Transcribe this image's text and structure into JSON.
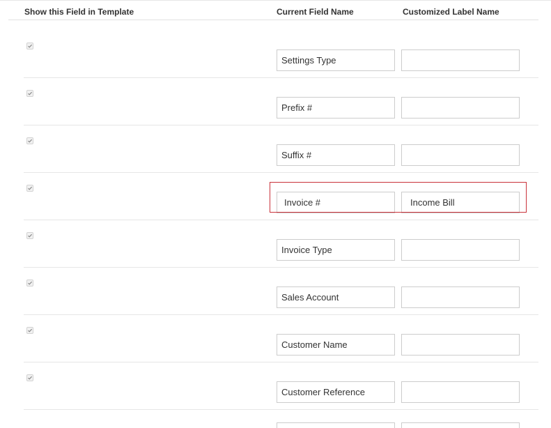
{
  "table": {
    "headers": {
      "show": "Show this Field in Template",
      "current": "Current Field Name",
      "custom": "Customized Label Name"
    },
    "rows": [
      {
        "current_name": "Settings Type",
        "custom_label": "",
        "checked": true
      },
      {
        "current_name": "Prefix #",
        "custom_label": "",
        "checked": true
      },
      {
        "current_name": "Suffix #",
        "custom_label": "",
        "checked": true
      },
      {
        "current_name": "Invoice #",
        "custom_label": "Income Bill",
        "checked": true,
        "highlighted": true
      },
      {
        "current_name": "Invoice Type",
        "custom_label": "",
        "checked": true
      },
      {
        "current_name": "Sales Account",
        "custom_label": "",
        "checked": true
      },
      {
        "current_name": "Customer Name",
        "custom_label": "",
        "checked": true
      },
      {
        "current_name": "Customer Reference",
        "custom_label": "",
        "checked": true
      }
    ]
  },
  "colors": {
    "highlight_border": "#c9323a",
    "field_border": "#cccccc",
    "row_divider": "#e6e6e6"
  }
}
